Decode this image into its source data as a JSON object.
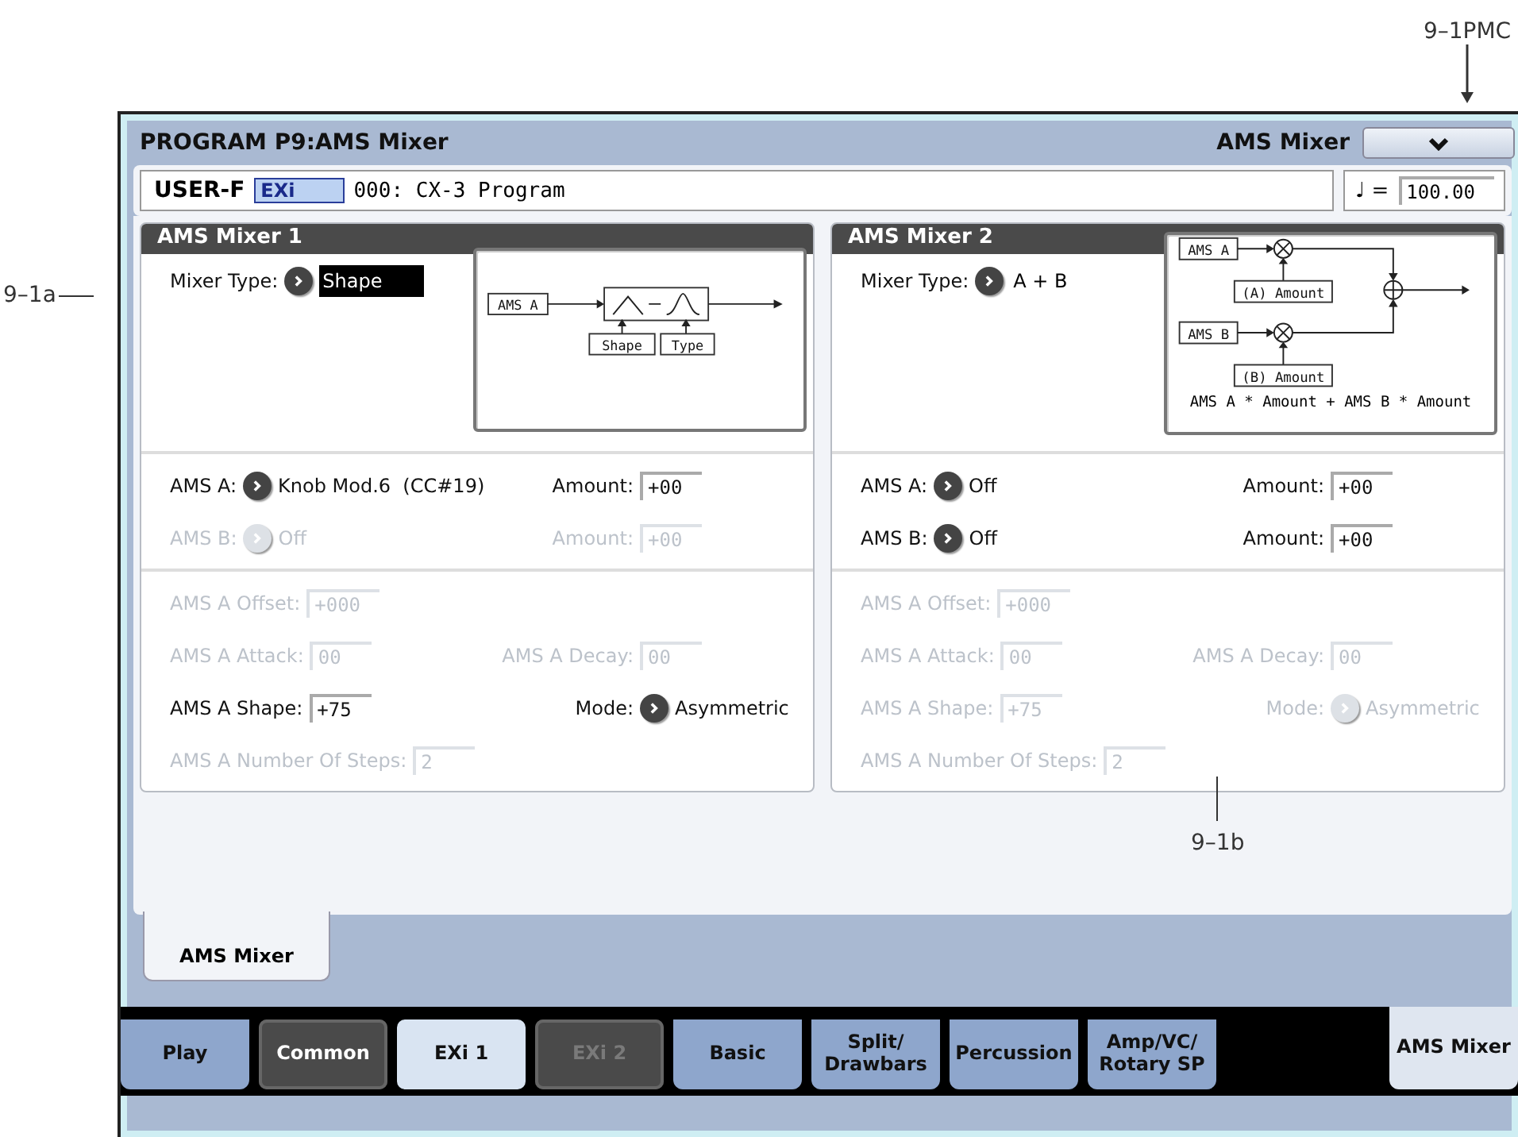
{
  "callouts": [
    {
      "kind": "menu",
      "text": "9–1PMC"
    },
    {
      "kind": "left",
      "text": "9–1a"
    },
    {
      "kind": "below",
      "text": "9–1b"
    }
  ],
  "header": {
    "title": "PROGRAM P9:AMS Mixer",
    "page": "AMS Mixer"
  },
  "program": {
    "bank": "USER-F",
    "type_badge": "EXi",
    "name": "000: CX-3 Program"
  },
  "tempo": {
    "symbol": "♩",
    "label": "=",
    "value": "100.00"
  },
  "panels": [
    {
      "title": "AMS Mixer 1",
      "mixer_type": {
        "label": "Mixer Type:",
        "value": "Shape",
        "selected": true
      },
      "diagram": {
        "kind": "shape",
        "labels": [
          "AMS A",
          "Shape",
          "Type"
        ]
      },
      "sections": [
        [
          {
            "left": {
              "label": "AMS A:",
              "kind": "select",
              "value": "Knob Mod.6  (CC#19)",
              "disabled": false
            },
            "right": {
              "label": "Amount:",
              "kind": "field",
              "value": "+00",
              "disabled": false
            }
          },
          {
            "left": {
              "label": "AMS B:",
              "kind": "select",
              "value": "Off",
              "disabled": true
            },
            "right": {
              "label": "Amount:",
              "kind": "field",
              "value": "+00",
              "disabled": true
            }
          }
        ],
        [
          {
            "left": {
              "label": "AMS A Offset:",
              "kind": "field",
              "value": "+000",
              "disabled": true
            }
          },
          {
            "left": {
              "label": "AMS A Attack:",
              "kind": "field",
              "value": "00",
              "disabled": true
            },
            "right": {
              "label": "AMS A Decay:",
              "kind": "field",
              "value": "00",
              "disabled": true
            }
          },
          {
            "left": {
              "label": "AMS A Shape:",
              "kind": "field",
              "value": "+75",
              "disabled": false
            },
            "right": {
              "label": "Mode:",
              "kind": "select",
              "value": "Asymmetric",
              "disabled": false
            }
          },
          {
            "left": {
              "label": "AMS A Number Of Steps:",
              "kind": "field",
              "value": "2",
              "disabled": true
            }
          }
        ]
      ]
    },
    {
      "title": "AMS Mixer 2",
      "mixer_type": {
        "label": "Mixer Type:",
        "value": "A + B",
        "selected": false
      },
      "diagram": {
        "kind": "sum",
        "labels": [
          "AMS A",
          "(A) Amount",
          "AMS B",
          "(B) Amount"
        ],
        "caption": "AMS A * Amount + AMS B * Amount"
      },
      "sections": [
        [
          {
            "left": {
              "label": "AMS A:",
              "kind": "select",
              "value": "Off",
              "disabled": false
            },
            "right": {
              "label": "Amount:",
              "kind": "field",
              "value": "+00",
              "disabled": false
            }
          },
          {
            "left": {
              "label": "AMS B:",
              "kind": "select",
              "value": "Off",
              "disabled": false
            },
            "right": {
              "label": "Amount:",
              "kind": "field",
              "value": "+00",
              "disabled": false
            }
          }
        ],
        [
          {
            "left": {
              "label": "AMS A Offset:",
              "kind": "field",
              "value": "+000",
              "disabled": true
            }
          },
          {
            "left": {
              "label": "AMS A Attack:",
              "kind": "field",
              "value": "00",
              "disabled": true
            },
            "right": {
              "label": "AMS A Decay:",
              "kind": "field",
              "value": "00",
              "disabled": true
            }
          },
          {
            "left": {
              "label": "AMS A Shape:",
              "kind": "field",
              "value": "+75",
              "disabled": true
            },
            "right": {
              "label": "Mode:",
              "kind": "select",
              "value": "Asymmetric",
              "disabled": true
            }
          },
          {
            "left": {
              "label": "AMS A Number Of Steps:",
              "kind": "field",
              "value": "2",
              "disabled": true
            }
          }
        ]
      ]
    }
  ],
  "sub_tabs": [
    {
      "label": "AMS Mixer",
      "selected": true
    }
  ],
  "page_tabs": [
    {
      "label": "Play",
      "kind": "page",
      "disabled": false,
      "selected": false
    },
    {
      "label": "Common",
      "kind": "group",
      "disabled": false,
      "selected": false
    },
    {
      "label": "EXi 1",
      "kind": "exi",
      "disabled": false,
      "selected": false
    },
    {
      "label": "EXi 2",
      "kind": "group",
      "disabled": true,
      "selected": false
    },
    {
      "label": "Basic",
      "kind": "page",
      "disabled": false,
      "selected": false
    },
    {
      "label": "Split/\nDrawbars",
      "kind": "page",
      "disabled": false,
      "selected": false
    },
    {
      "label": "Percussion",
      "kind": "page",
      "disabled": false,
      "selected": false
    },
    {
      "label": "Amp/VC/\nRotary SP",
      "kind": "page",
      "disabled": false,
      "selected": false
    },
    {
      "label": "AMS Mixer",
      "kind": "page",
      "disabled": false,
      "selected": true
    }
  ]
}
